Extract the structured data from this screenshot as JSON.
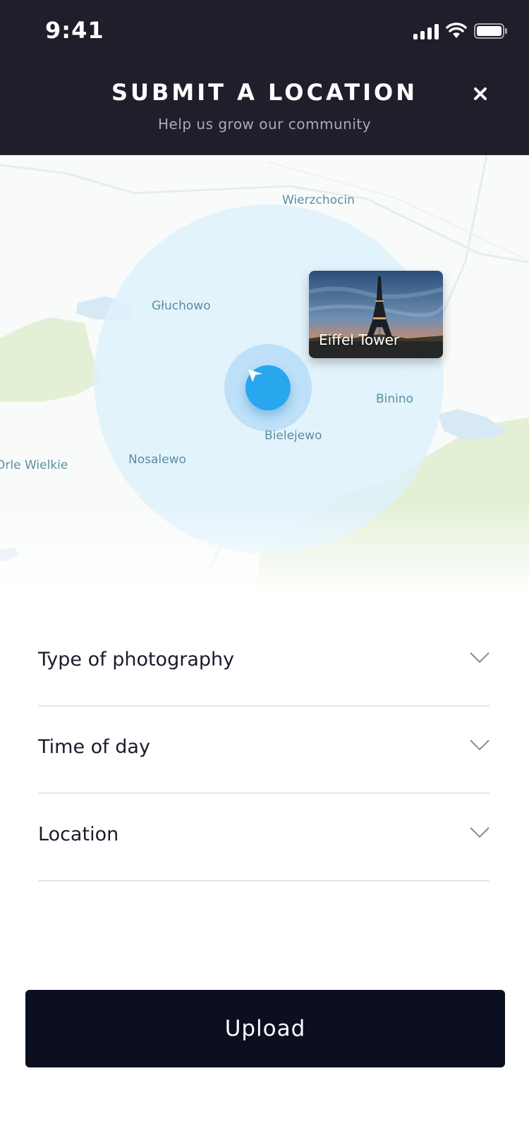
{
  "status_bar": {
    "time": "9:41"
  },
  "header": {
    "title": "SUBMIT A LOCATION",
    "subtitle": "Help us grow our community"
  },
  "map": {
    "place_labels": [
      "Wierzchocin",
      "Głuchowo",
      "Binino",
      "Bielejewo",
      "Nosalewo",
      "Orle Wielkie"
    ],
    "poi_card": {
      "label": "Eiffel Tower"
    },
    "colors": {
      "radius": "#dff1fb",
      "land": "#e4f0d6",
      "water": "#d6e9f5",
      "locate": "#29a7ee"
    }
  },
  "form": {
    "fields": [
      {
        "label": "Type of photography"
      },
      {
        "label": "Time of day"
      },
      {
        "label": "Location"
      }
    ]
  },
  "actions": {
    "upload_label": "Upload"
  }
}
